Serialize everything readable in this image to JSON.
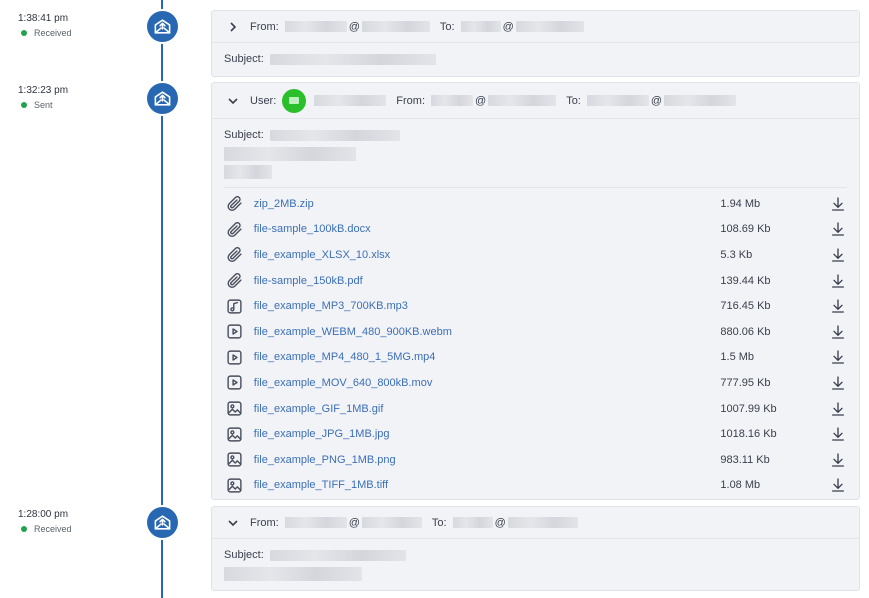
{
  "labels": {
    "from": "From:",
    "to": "To:",
    "user": "User:",
    "subject": "Subject:",
    "at": "@"
  },
  "entries": [
    {
      "time": "1:38:41 pm",
      "status": "Received",
      "status_color": "#23a24d"
    },
    {
      "time": "1:32:23 pm",
      "status": "Sent",
      "status_color": "#23a24d"
    },
    {
      "time": "1:28:00 pm",
      "status": "Received",
      "status_color": "#23a24d"
    }
  ],
  "icons": {
    "timeline_node": "envelope-up-icon",
    "collapsed": "chevron-right-icon",
    "expanded": "chevron-down-icon",
    "download": "download-icon"
  },
  "attachments": [
    {
      "name": "zip_2MB.zip",
      "size": "1.94 Mb",
      "icon": "paperclip-icon"
    },
    {
      "name": "file-sample_100kB.docx",
      "size": "108.69 Kb",
      "icon": "paperclip-icon"
    },
    {
      "name": "file_example_XLSX_10.xlsx",
      "size": "5.3 Kb",
      "icon": "paperclip-icon"
    },
    {
      "name": "file-sample_150kB.pdf",
      "size": "139.44 Kb",
      "icon": "paperclip-icon"
    },
    {
      "name": "file_example_MP3_700KB.mp3",
      "size": "716.45 Kb",
      "icon": "music-file-icon"
    },
    {
      "name": "file_example_WEBM_480_900KB.webm",
      "size": "880.06 Kb",
      "icon": "video-file-icon"
    },
    {
      "name": "file_example_MP4_480_1_5MG.mp4",
      "size": "1.5 Mb",
      "icon": "video-file-icon"
    },
    {
      "name": "file_example_MOV_640_800kB.mov",
      "size": "777.95 Kb",
      "icon": "video-file-icon"
    },
    {
      "name": "file_example_GIF_1MB.gif",
      "size": "1007.99 Kb",
      "icon": "image-file-icon"
    },
    {
      "name": "file_example_JPG_1MB.jpg",
      "size": "1018.16 Kb",
      "icon": "image-file-icon"
    },
    {
      "name": "file_example_PNG_1MB.png",
      "size": "983.11 Kb",
      "icon": "image-file-icon"
    },
    {
      "name": "file_example_TIFF_1MB.tiff",
      "size": "1.08 Mb",
      "icon": "image-file-icon"
    }
  ],
  "colors": {
    "accent": "#2867b2",
    "link": "#3b6fb6",
    "avatar": "#2bc02b",
    "card_bg": "#f2f3f7"
  }
}
